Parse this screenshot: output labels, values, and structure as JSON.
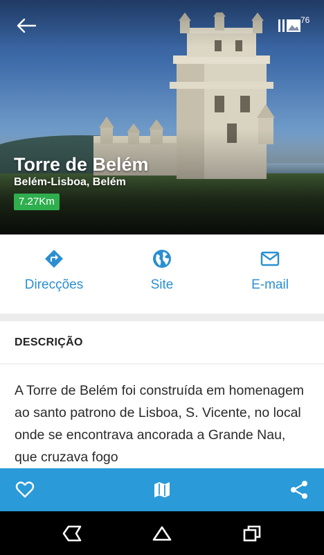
{
  "hero": {
    "title": "Torre de Belém",
    "subtitle": "Belém-Lisboa, Belém",
    "distance": "7.27Km",
    "photo_count": "76",
    "badge_color": "#2fae4d"
  },
  "actions": [
    {
      "label": "Direcções",
      "icon": "directions-icon"
    },
    {
      "label": "Site",
      "icon": "globe-icon"
    },
    {
      "label": "E-mail",
      "icon": "mail-icon"
    }
  ],
  "description": {
    "heading": "DESCRIÇÃO",
    "text": "A Torre de Belém foi construída em homenagem ao santo patrono de Lisboa, S. Vicente, no local onde se encontrava ancorada a Grande Nau, que cruzava fogo"
  },
  "bottom_bar": {
    "color": "#2a9ad8",
    "buttons": [
      "heart-icon",
      "map-icon",
      "share-icon"
    ]
  },
  "accent_color": "#2a8fd1",
  "navbar": {
    "buttons": [
      "back-icon",
      "home-icon",
      "recents-icon"
    ]
  }
}
